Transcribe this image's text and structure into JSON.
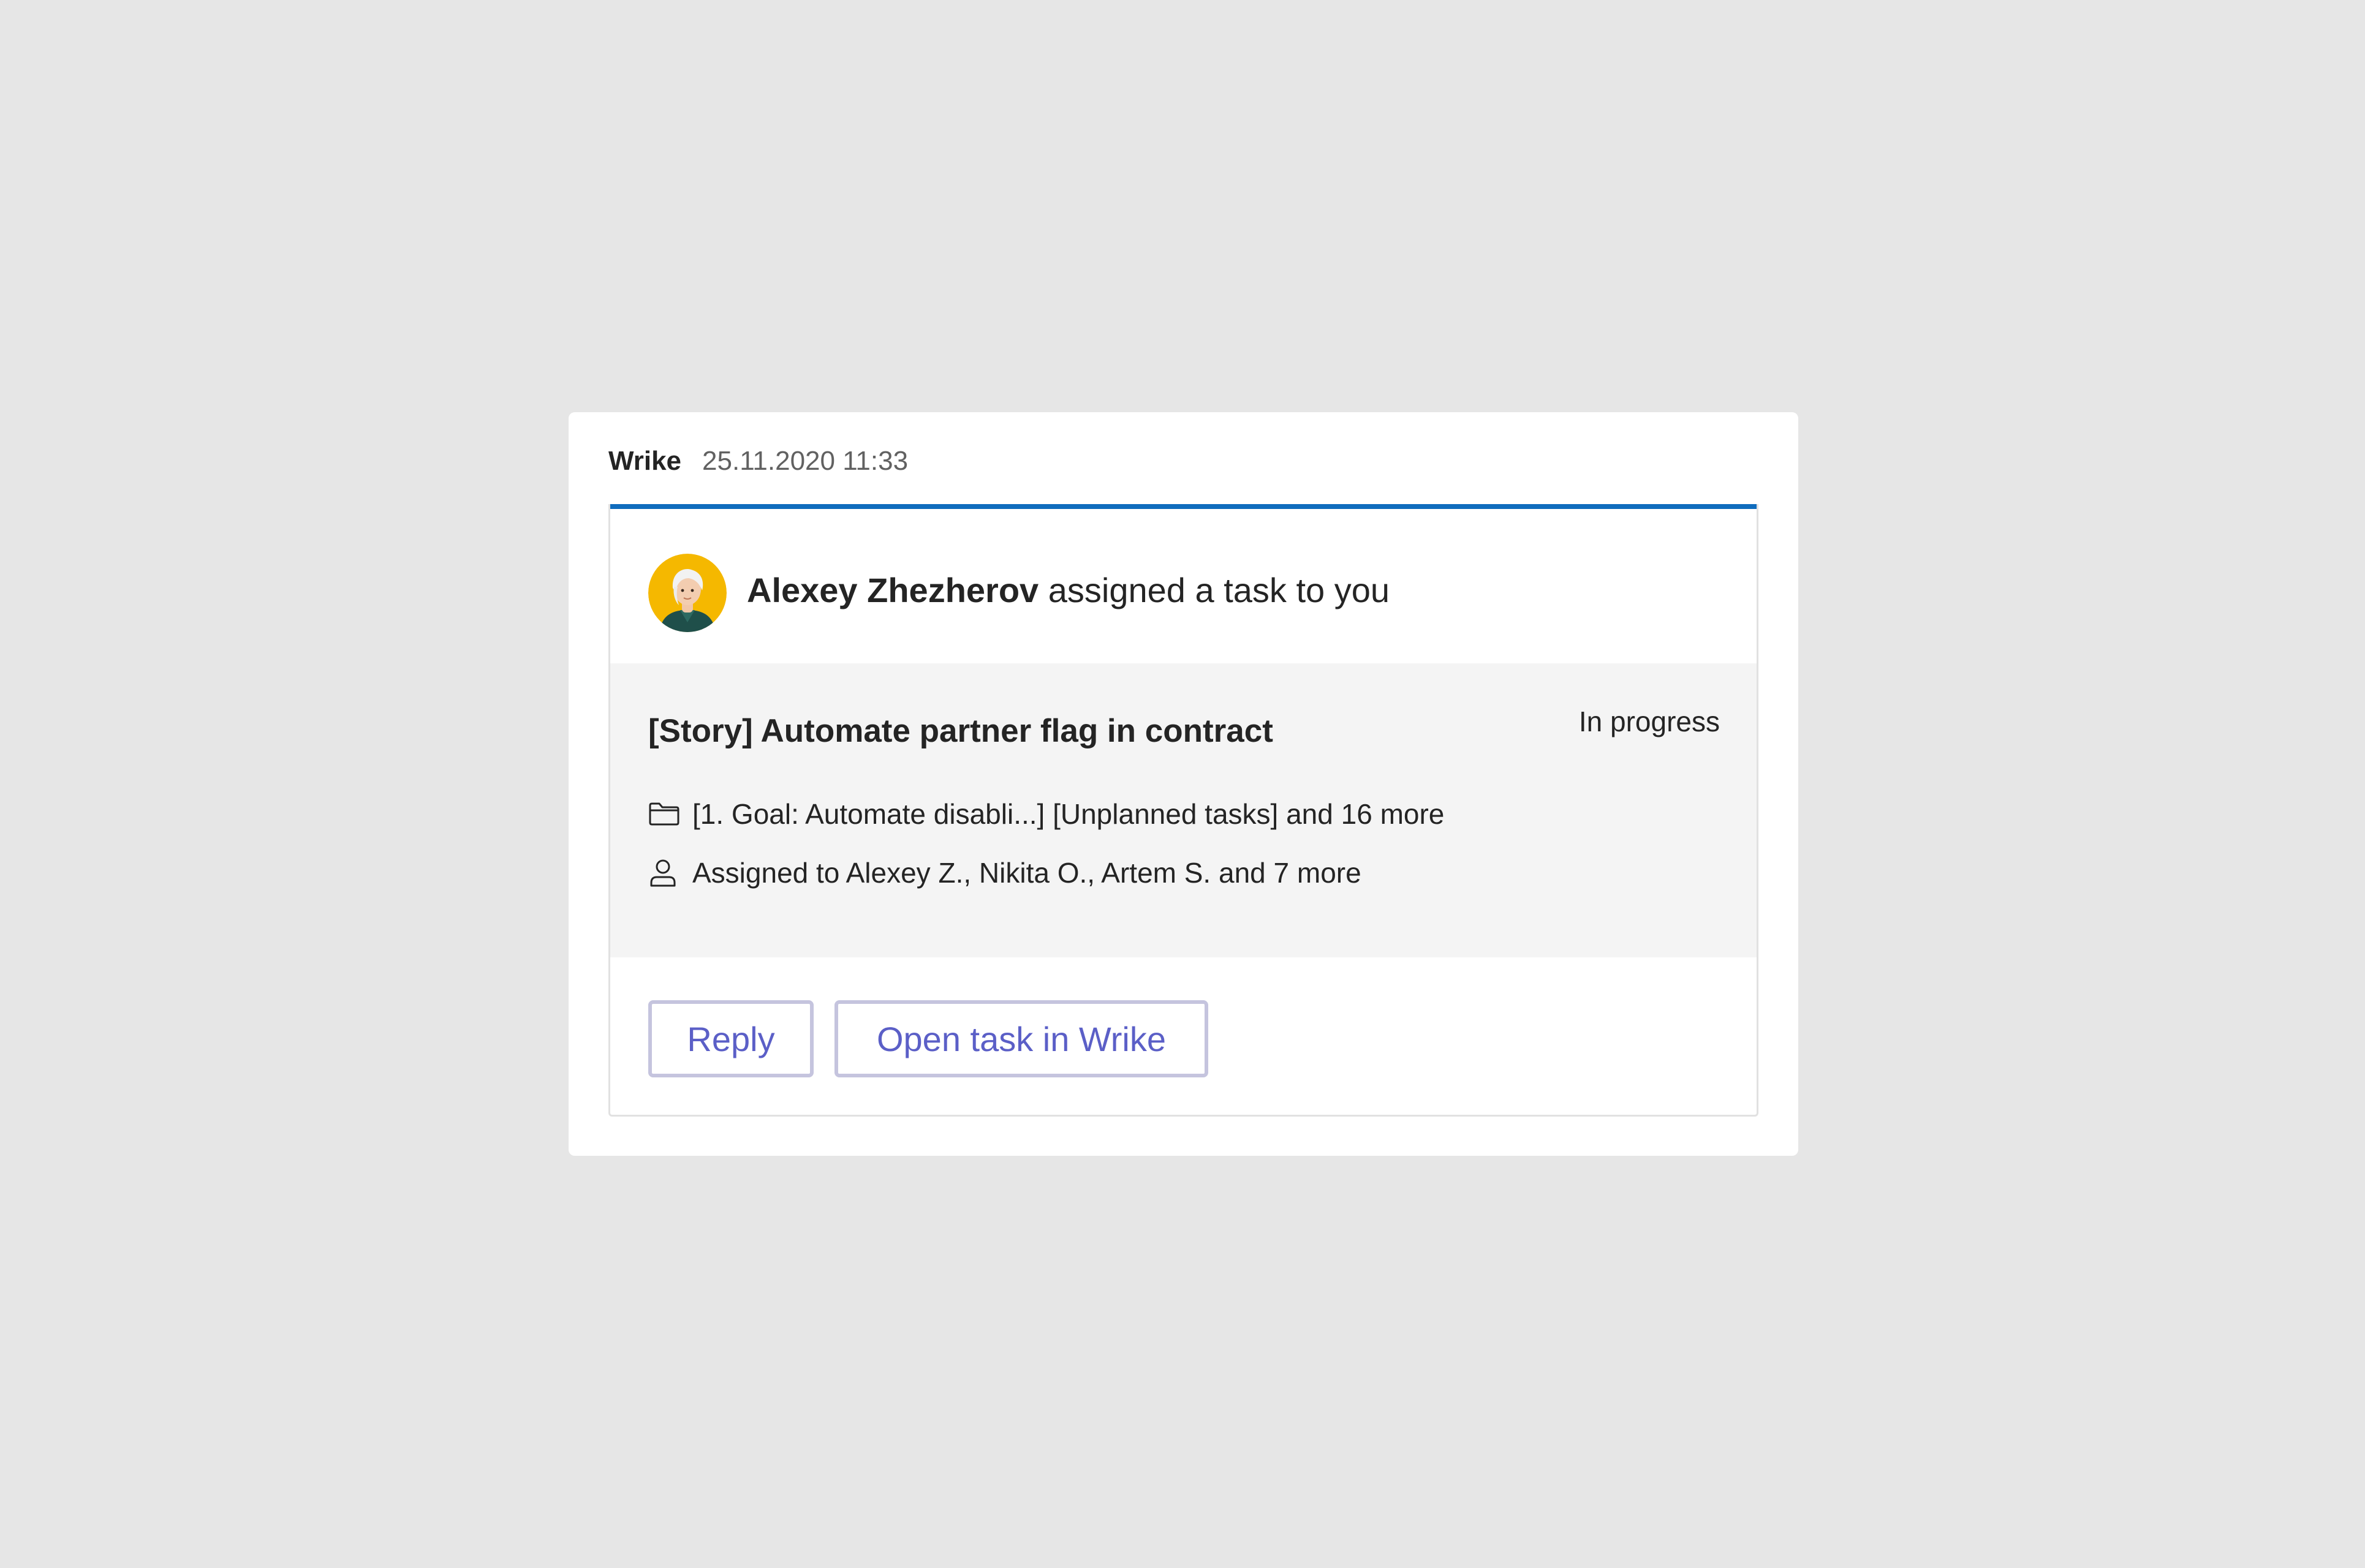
{
  "message": {
    "sender": "Wrike",
    "timestamp": "25.11.2020 11:33"
  },
  "card": {
    "accent_color": "#0f6cbd",
    "avatar_icon": "user-avatar-illustration",
    "actor_name": "Alexey Zhezherov",
    "action_text": " assigned a task to you",
    "task": {
      "title": "[Story] Automate partner flag in contract",
      "status": "In progress",
      "folders_icon": "folder-icon",
      "folders": "[1. Goal: Automate disabli...] [Unplanned tasks] and 16 more",
      "assignees_icon": "person-icon",
      "assignees": "Assigned to Alexey Z., Nikita O., Artem S. and 7 more"
    },
    "actions": {
      "reply_label": "Reply",
      "open_label": "Open task in Wrike"
    }
  }
}
